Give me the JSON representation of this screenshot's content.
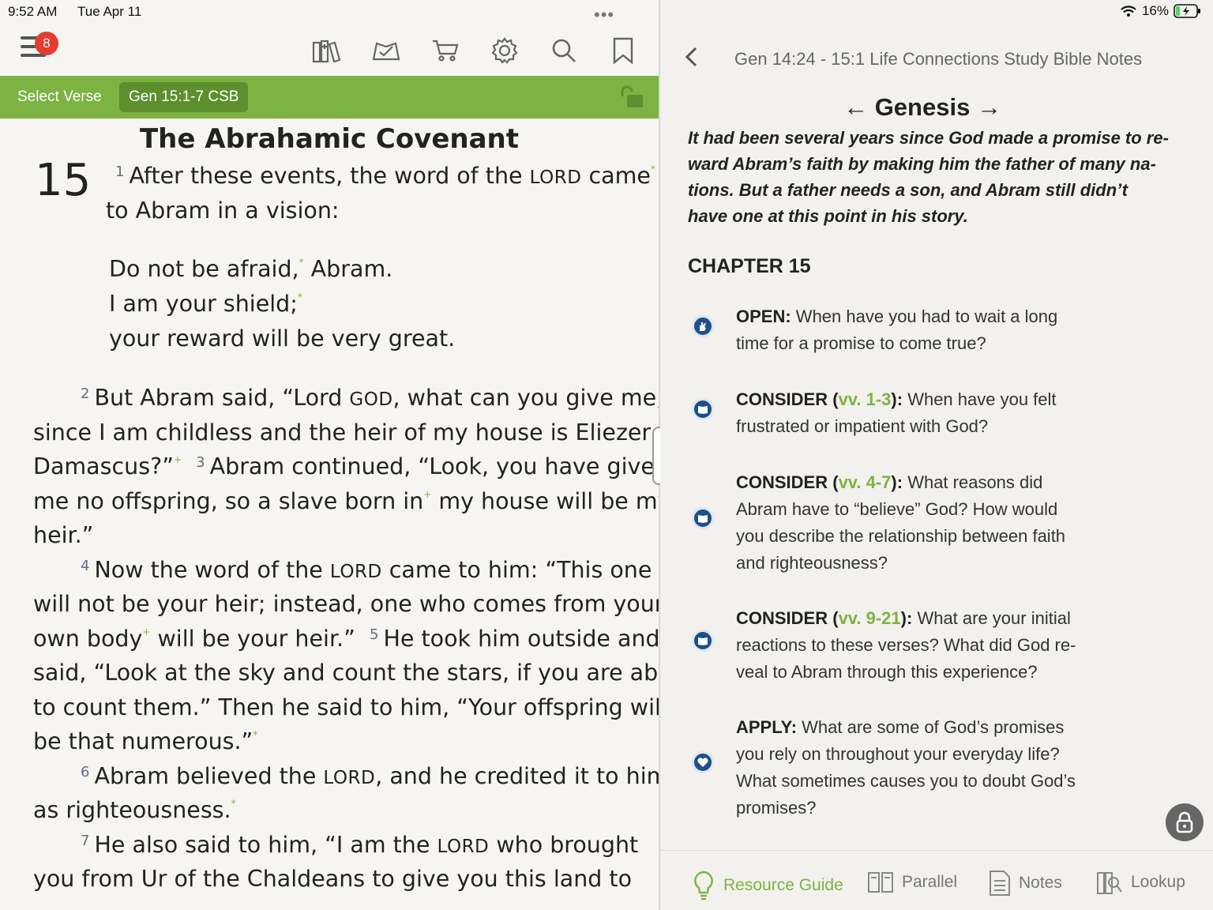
{
  "status": {
    "time": "9:52 AM",
    "date": "Tue Apr 11",
    "battery": "16%"
  },
  "toolbar": {
    "menu_badge": "8"
  },
  "greenbar": {
    "select_verse": "Select Verse",
    "reference": "Gen 15:1-7 CSB"
  },
  "passage": {
    "heading": "The Abrahamic Covenant",
    "chapter": "15",
    "v1_num": "1",
    "v1_a": "After these events, the word of the ",
    "v1_lord": "Lord",
    "v1_b": " came",
    "v1_c": "to Abram in a vision:",
    "poem1": "Do not be afraid,",
    "poem1b": " Abram.",
    "poem2": "I am your shield;",
    "poem3": "your reward will be very great.",
    "v2_num": "2",
    "v2_a": "But Abram said, “Lord ",
    "v2_god": "God",
    "v2_b": ", what can you give me,",
    "v2_c": "since I am childless and the heir of my house is Eliezer of",
    "v2_d": "Damascus?”",
    "v3_num": "3",
    "v3_a": "Abram continued, “Look, you have given",
    "v3_b": "me no offspring, so a slave born in",
    "v3_c": " my house will be my",
    "v3_d": "heir.”",
    "v4_num": "4",
    "v4_a": "Now the word of the ",
    "v4_lord": "Lord",
    "v4_b": " came to him: “This one",
    "v4_c": "will not be your heir; instead, one who comes from your",
    "v4_d": "own body",
    "v4_e": " will be your heir.”",
    "v5_num": "5",
    "v5_a": "He took him outside and",
    "v5_b": "said, “Look at the sky and count the stars, if you are able",
    "v5_c": "to count them.” Then he said to him, “Your offspring will",
    "v5_d": "be that numerous.”",
    "v6_num": "6",
    "v6_a": "Abram believed the ",
    "v6_lord": "Lord",
    "v6_b": ", and he credited it to him",
    "v6_c": "as righteousness.",
    "v7_num": "7",
    "v7_a": "He also said to him, “I am the ",
    "v7_lord": "Lord",
    "v7_b": " who brought",
    "v7_c": "you from Ur of the Chaldeans to give you this land to",
    "fn_star": "*",
    "fn_plus": "+"
  },
  "notes": {
    "title": "Gen 14:24 - 15:1 Life Connections Study Bible Notes",
    "book": "Genesis",
    "intro": "It had been several years since God made a promise to re-ward Abram’s faith by making him the father of many na-tions. But a father needs a son, and Abram still didn’t have one at this point in his story.",
    "chapter_heading": "CHAPTER 15",
    "questions": [
      {
        "label": "OPEN:",
        "vref": "",
        "text": " When have you had to wait a long time for a promise to come true?",
        "icon": "hand-icon"
      },
      {
        "label": "CONSIDER (",
        "vref": "vv. 1-3",
        "label2": "):",
        "text": " When have you felt frustrated or impatient with God?",
        "icon": "book-icon"
      },
      {
        "label": "CONSIDER (",
        "vref": "vv. 4-7",
        "label2": "):",
        "text": " What reasons did Abram have to “believe” God? How would you describe the relationship between faith and righteousness?",
        "icon": "book-icon"
      },
      {
        "label": "CONSIDER (",
        "vref": "vv. 9-21",
        "label2": "):",
        "text": " What are your initial reactions to these verses? What did God re-veal to Abram through this experience?",
        "icon": "book-icon"
      },
      {
        "label": "APPLY:",
        "vref": "",
        "text": " What are some of God’s promises you rely on throughout your everyday life? What sometimes causes you to doubt God’s promises?",
        "icon": "heart-icon"
      }
    ]
  },
  "tabs": {
    "resource_guide": "Resource Guide",
    "parallel": "Parallel",
    "notes": "Notes",
    "lookup": "Lookup"
  }
}
